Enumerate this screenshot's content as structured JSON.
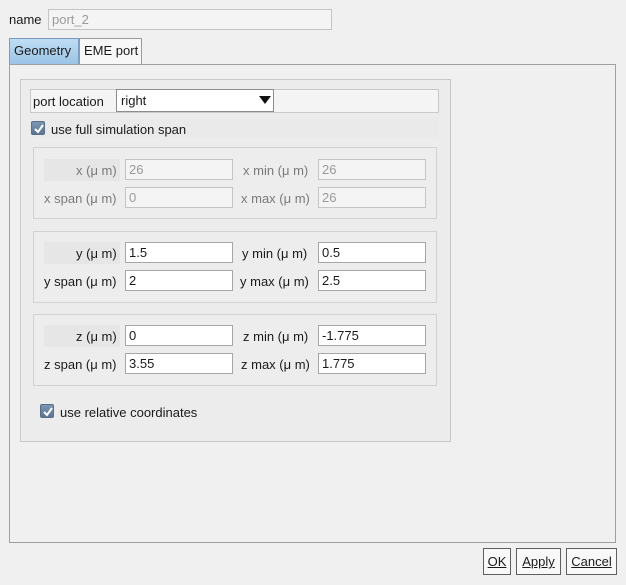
{
  "name": {
    "label": "name",
    "value": "port_2"
  },
  "tabs": [
    {
      "label": "Geometry",
      "active": true
    },
    {
      "label": "EME port",
      "active": false
    }
  ],
  "port_location": {
    "label": "port location",
    "value": "right"
  },
  "full_span": {
    "label": "use full simulation span",
    "checked": true
  },
  "x_group": {
    "x_label": "x (μ m)",
    "x_value": "26",
    "xmin_label": "x min (μ m)",
    "xmin_value": "26",
    "xspan_label": "x span (μ m)",
    "xspan_value": "0",
    "xmax_label": "x max (μ m)",
    "xmax_value": "26"
  },
  "y_group": {
    "y_label": "y (μ m)",
    "y_value": "1.5",
    "ymin_label": "y min (μ m)",
    "ymin_value": "0.5",
    "yspan_label": "y span (μ m)",
    "yspan_value": "2",
    "ymax_label": "y max (μ m)",
    "ymax_value": "2.5"
  },
  "z_group": {
    "z_label": "z (μ m)",
    "z_value": "0",
    "zmin_label": "z min (μ m)",
    "zmin_value": "-1.775",
    "zspan_label": "z span (μ m)",
    "zspan_value": "3.55",
    "zmax_label": "z max (μ m)",
    "zmax_value": "1.775"
  },
  "relative_coords": {
    "label": "use relative coordinates",
    "checked": true
  },
  "buttons": {
    "ok": "OK",
    "apply": "Apply",
    "cancel": "Cancel"
  }
}
